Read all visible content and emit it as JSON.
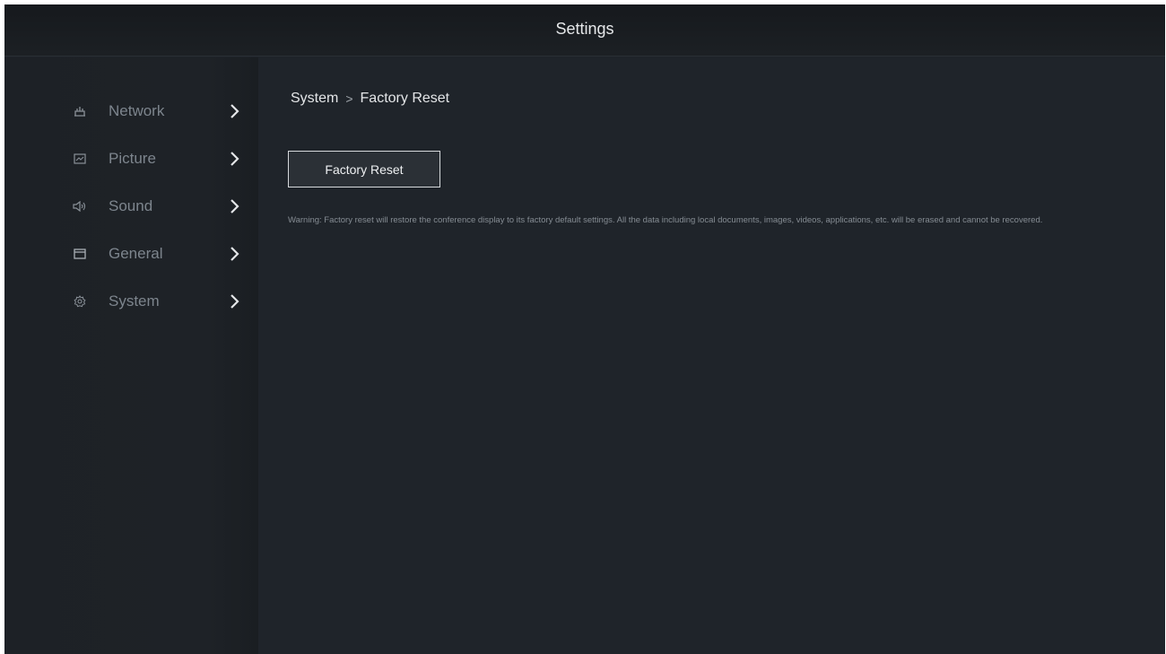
{
  "header": {
    "title": "Settings"
  },
  "sidebar": {
    "items": [
      {
        "label": "Network",
        "icon": "network-icon"
      },
      {
        "label": "Picture",
        "icon": "picture-icon"
      },
      {
        "label": "Sound",
        "icon": "speaker-icon"
      },
      {
        "label": "General",
        "icon": "general-icon"
      },
      {
        "label": "System",
        "icon": "gear-icon"
      }
    ]
  },
  "main": {
    "breadcrumb": {
      "parent": "System",
      "separator": ">",
      "current": "Factory Reset"
    },
    "factory_reset_button": "Factory Reset",
    "warning": "Warning: Factory reset will restore the conference display to its factory default settings. All the data including local documents, images, videos, applications, etc. will be erased and cannot be recovered."
  },
  "colors": {
    "background": "#1e2329",
    "topbar": "#16191d",
    "text_primary": "#e6e8ea",
    "text_muted": "#7d858d",
    "button_border": "#d6d9dc"
  }
}
